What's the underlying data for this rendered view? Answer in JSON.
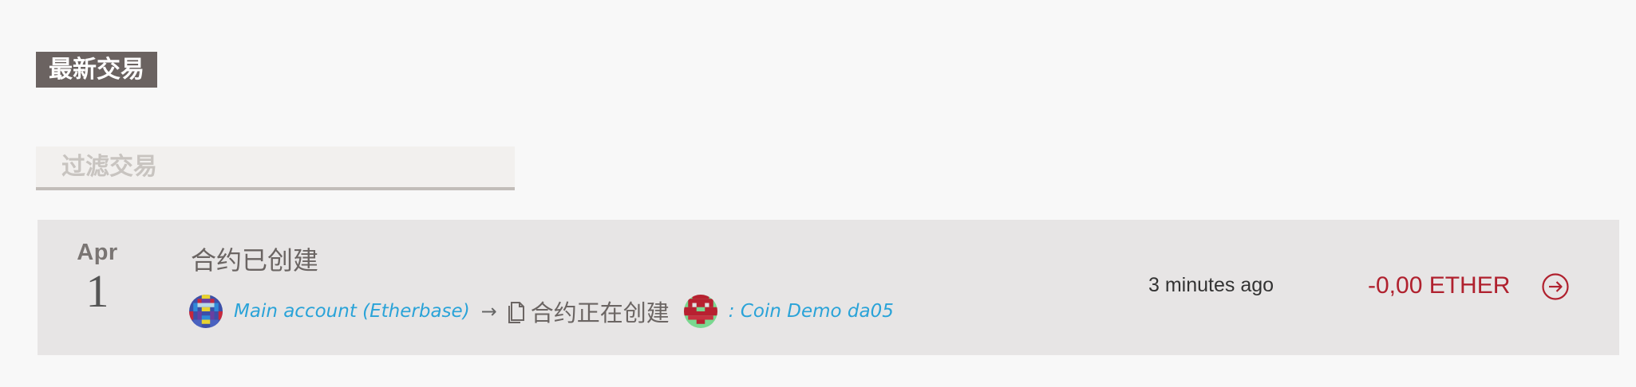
{
  "section": {
    "title": "最新交易"
  },
  "filter": {
    "placeholder": "过滤交易",
    "value": ""
  },
  "transactions": [
    {
      "month": "Apr",
      "day": "1",
      "title": "合约已创建",
      "from": {
        "label": "Main account (Etherbase)",
        "icon": "identicon-avatar"
      },
      "arrow": "→",
      "contract_status": "合约正在创建",
      "contract_icon": "document-icon",
      "to": {
        "label": ": Coin Demo da05",
        "icon": "identicon-avatar"
      },
      "time": "3 minutes ago",
      "amount": "-0,00 ETHER",
      "detail_icon": "arrow-circle-right-icon"
    }
  ],
  "colors": {
    "title_bg": "#6b6361",
    "row_bg": "#e7e5e5",
    "link": "#2aa3d8",
    "amount": "#b0212e"
  }
}
